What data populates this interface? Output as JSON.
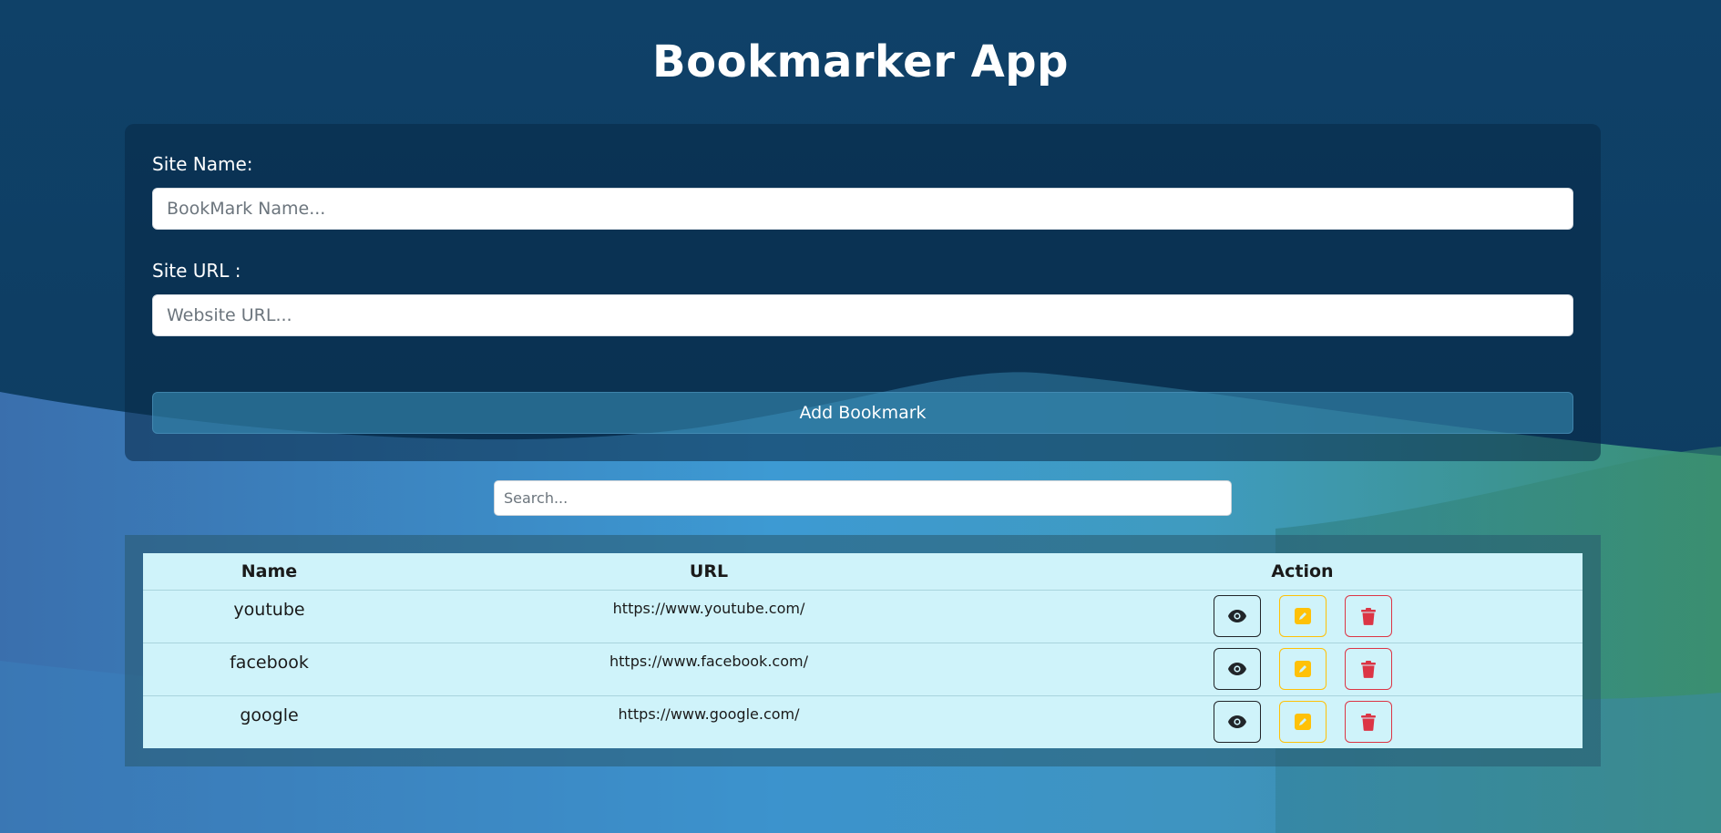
{
  "app": {
    "title": "Bookmarker App"
  },
  "form": {
    "site_name_label": "Site Name:",
    "site_name_placeholder": "BookMark Name...",
    "site_name_value": "",
    "site_url_label": "Site URL :",
    "site_url_placeholder": "Website URL...",
    "site_url_value": "",
    "add_button_label": "Add Bookmark"
  },
  "search": {
    "placeholder": "Search...",
    "value": ""
  },
  "table": {
    "headers": {
      "name": "Name",
      "url": "URL",
      "action": "Action"
    },
    "rows": [
      {
        "name": "youtube",
        "url": "https://www.youtube.com/"
      },
      {
        "name": "facebook",
        "url": "https://www.facebook.com/"
      },
      {
        "name": "google",
        "url": "https://www.google.com/"
      }
    ],
    "action_icons": {
      "view": "eye-icon",
      "edit": "pencil-square-icon",
      "delete": "trash-icon"
    }
  },
  "colors": {
    "background_top": "#0f4168",
    "background_wave": "#3d9ad3",
    "background_wave_green": "#3a8f72",
    "table_bg": "#cff3fa",
    "view_border": "#212529",
    "edit_color": "#ffc107",
    "delete_color": "#dc3545"
  }
}
